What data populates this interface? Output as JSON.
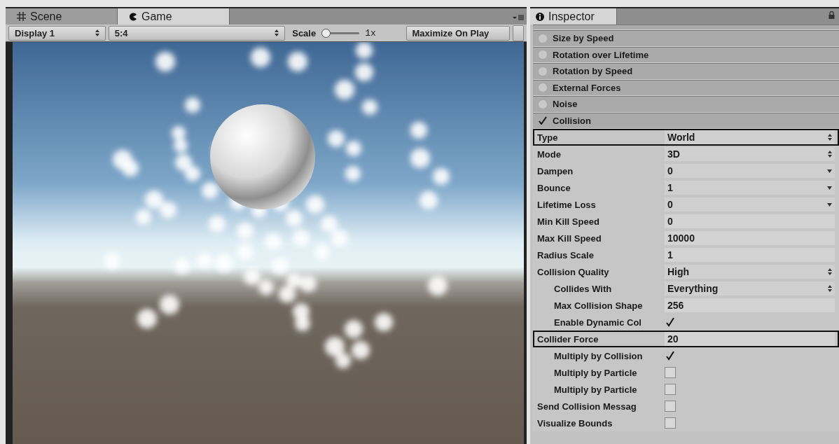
{
  "game_panel": {
    "tabs": [
      {
        "label": "Scene",
        "selected": false
      },
      {
        "label": "Game",
        "selected": true
      }
    ],
    "toolbar": {
      "display": "Display 1",
      "aspect": "5:4",
      "scale_label": "Scale",
      "scale": {
        "level": 0
      },
      "scale_reading": "1x",
      "maximize_button": {
        "label": "Maximize On Play",
        "on": false
      }
    }
  },
  "inspector": {
    "tab": {
      "label": "Inspector",
      "selected": true
    },
    "modules": [
      {
        "label": "Size by Speed",
        "enabled": false
      },
      {
        "label": "Rotation over Lifetime",
        "enabled": false
      },
      {
        "label": "Rotation by Speed",
        "enabled": false
      },
      {
        "label": "External Forces",
        "enabled": false
      },
      {
        "label": "Noise",
        "enabled": false
      },
      {
        "label": "Collision",
        "enabled": true
      }
    ],
    "properties": [
      {
        "label": "Type",
        "kind": "dropdown",
        "value": "World",
        "highlighted": true
      },
      {
        "label": "Mode",
        "kind": "dropdown",
        "value": "3D",
        "highlighted": false
      },
      {
        "label": "Dampen",
        "kind": "curve",
        "value": "0",
        "highlighted": false
      },
      {
        "label": "Bounce",
        "kind": "curve",
        "value": "1",
        "highlighted": false
      },
      {
        "label": "Lifetime Loss",
        "kind": "curve",
        "value": "0",
        "highlighted": false
      },
      {
        "label": "Min Kill Speed",
        "kind": "number",
        "value": "0",
        "highlighted": false
      },
      {
        "label": "Max Kill Speed",
        "kind": "number",
        "value": "10000",
        "highlighted": false
      },
      {
        "label": "Radius Scale",
        "kind": "number",
        "value": "1",
        "highlighted": false
      },
      {
        "label": "Collision Quality",
        "kind": "dropdown",
        "value": "High",
        "highlighted": false,
        "children": [
          {
            "label": "Collides With",
            "kind": "dropdown",
            "value": "Everything",
            "highlighted": false
          },
          {
            "label": "Max Collision Shape",
            "kind": "number",
            "value": "256",
            "highlighted": false
          },
          {
            "label": "Enable Dynamic Col",
            "kind": "checkbox",
            "checked": true,
            "highlighted": false
          }
        ]
      },
      {
        "label": "Collider Force",
        "kind": "number",
        "value": "20",
        "highlighted": true,
        "children": [
          {
            "label": "Multiply by Collision",
            "kind": "checkbox",
            "checked": true,
            "highlighted": false
          },
          {
            "label": "Multiply by Particle",
            "kind": "checkbox",
            "checked": false,
            "highlighted": false
          },
          {
            "label": "Multiply by Particle",
            "kind": "checkbox",
            "checked": false,
            "highlighted": false
          }
        ]
      },
      {
        "label": "Send Collision Messag",
        "kind": "checkbox",
        "checked": false,
        "highlighted": false
      },
      {
        "label": "Visualize Bounds",
        "kind": "checkbox",
        "checked": false,
        "highlighted": false
      }
    ]
  }
}
